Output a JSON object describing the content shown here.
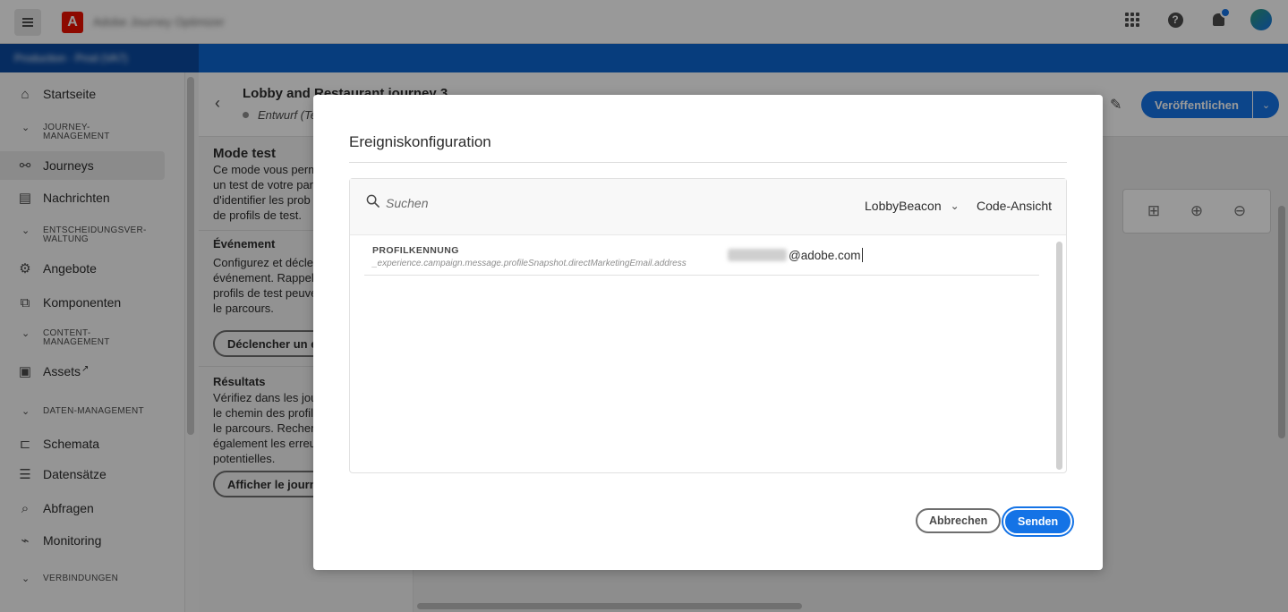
{
  "topbar": {
    "org_name": "Adobe Journey Optimizer",
    "logo_letter": "A"
  },
  "bluebar": {
    "sandbox": "Production · Prod (VA7)"
  },
  "sidebar": {
    "home": "Startseite",
    "section_journey": "JOURNEY-\nMANAGEMENT",
    "journeys": "Journeys",
    "messages": "Nachrichten",
    "section_decision": "ENTSCHEIDUNGSVER-\nWALTUNG",
    "offers": "Angebote",
    "components": "Komponenten",
    "section_content": "CONTENT-\nMANAGEMENT",
    "assets": "Assets",
    "section_data": "DATEN-MANAGEMENT",
    "schemas": "Schemata",
    "datasets": "Datensätze",
    "queries": "Abfragen",
    "monitoring": "Monitoring",
    "section_connections": "VERBINDUNGEN"
  },
  "journey": {
    "title": "Lobby and Restaurant journey 3",
    "status": "Entwurf (Test)",
    "publish": "Veröffentlichen"
  },
  "test_panel": {
    "title": "Mode test",
    "intro": "Ce mode vous perm\nun test de votre par\nd'identifier les prob\nde profils de test.",
    "event_title": "Événement",
    "event_text": "Configurez et déclen\névénement. Rappel\nprofils de test peuve\nle parcours.",
    "trigger_btn": "Déclencher un é",
    "results_title": "Résultats",
    "results_text": "Vérifiez dans les jou\nle chemin des profil\nle parcours. Recherc\négalement les erreu\npotentielles.",
    "show_btn": "Afficher le journ"
  },
  "modal": {
    "title": "Ereigniskonfiguration",
    "search_placeholder": "Suchen",
    "event_selected": "LobbyBeacon",
    "code_view": "Code-Ansicht",
    "field_label": "PROFILKENNUNG",
    "field_path": "_experience.campaign.message.profileSnapshot.directMarketingEmail.address",
    "field_value_suffix": "@adobe.com",
    "cancel": "Abbrechen",
    "send": "Senden"
  }
}
